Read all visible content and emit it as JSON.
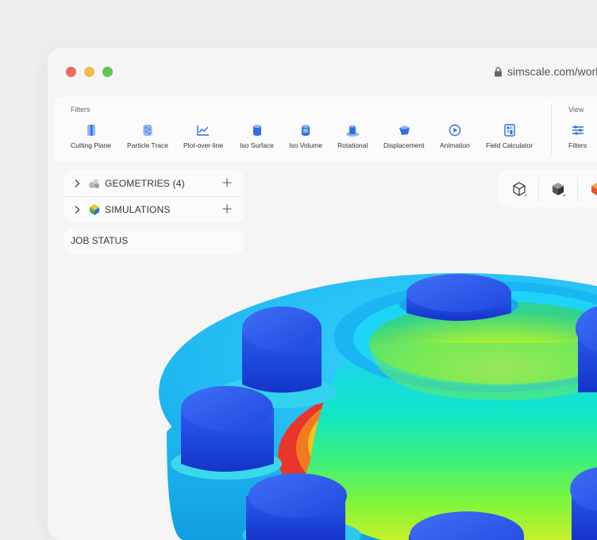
{
  "browser": {
    "url": "simscale.com/work",
    "lock_icon": "lock-icon"
  },
  "toolbar": {
    "filters_label": "Filters",
    "view_label": "View",
    "tools": [
      {
        "label": "Cutting Plane",
        "icon": "cutting-plane-icon"
      },
      {
        "label": "Particle Trace",
        "icon": "particle-trace-icon"
      },
      {
        "label": "Plot-over-line",
        "icon": "plot-over-line-icon"
      },
      {
        "label": "Iso Surface",
        "icon": "iso-surface-icon"
      },
      {
        "label": "Iso Volume",
        "icon": "iso-volume-icon"
      },
      {
        "label": "Rotational",
        "icon": "rotational-icon"
      },
      {
        "label": "Displacement",
        "icon": "displacement-icon"
      },
      {
        "label": "Animation",
        "icon": "animation-icon"
      },
      {
        "label": "Field Calculator",
        "icon": "field-calculator-icon"
      }
    ],
    "view_tools": [
      {
        "label": "Filters",
        "icon": "sliders-icon"
      }
    ]
  },
  "tree": {
    "items": [
      {
        "label": "GEOMETRIES (4)",
        "icon": "geometries-icon"
      },
      {
        "label": "SIMULATIONS",
        "icon": "simulations-icon"
      }
    ]
  },
  "job_status": {
    "label": "JOB STATUS"
  },
  "colors": {
    "accent": "#2f6fe0",
    "dot_red": "#ee6a5f",
    "dot_yellow": "#f5bd4f",
    "dot_green": "#61c554"
  }
}
